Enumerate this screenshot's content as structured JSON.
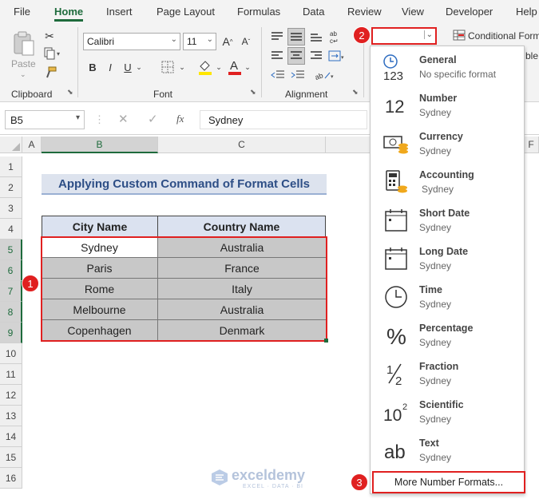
{
  "menu_tabs": [
    "File",
    "Home",
    "Insert",
    "Page Layout",
    "Formulas",
    "Data",
    "Review",
    "View",
    "Developer",
    "Help"
  ],
  "ribbon": {
    "clipboard": {
      "paste_label": "Paste",
      "group_label": "Clipboard"
    },
    "font": {
      "font_name": "Calibri",
      "font_size": "11",
      "group_label": "Font",
      "highlight_color": "#ffe600",
      "font_color": "#e02020"
    },
    "alignment": {
      "group_label": "Alignment"
    },
    "number": {
      "format_value": ""
    },
    "styles": {
      "conditional_label": "Conditional Form",
      "table_partial": "ble"
    }
  },
  "formula_bar": {
    "name_box": "B5",
    "fx": "fx",
    "content": "Sydney"
  },
  "grid": {
    "columns": [
      "A",
      "B",
      "C",
      "F"
    ],
    "rows": [
      "1",
      "2",
      "3",
      "4",
      "5",
      "6",
      "7",
      "8",
      "9",
      "10",
      "11",
      "12",
      "13",
      "14",
      "15",
      "16"
    ],
    "title": "Applying Custom Command of Format Cells",
    "headers": [
      "City Name",
      "Country Name"
    ],
    "data": [
      [
        "Sydney",
        "Australia"
      ],
      [
        "Paris",
        "France"
      ],
      [
        "Rome",
        "Italy"
      ],
      [
        "Melbourne",
        "Australia"
      ],
      [
        "Copenhagen",
        "Denmark"
      ]
    ]
  },
  "number_formats": [
    {
      "name": "General",
      "sub": "No specific format",
      "icon": "clock-123-icon"
    },
    {
      "name": "Number",
      "sub": "Sydney",
      "icon": "number-12-icon"
    },
    {
      "name": "Currency",
      "sub": "Sydney",
      "icon": "currency-icon"
    },
    {
      "name": "Accounting",
      "sub": "Sydney",
      "icon": "accounting-icon"
    },
    {
      "name": "Short Date",
      "sub": "Sydney",
      "icon": "calendar-icon"
    },
    {
      "name": "Long Date",
      "sub": "Sydney",
      "icon": "calendar-icon"
    },
    {
      "name": "Time",
      "sub": "Sydney",
      "icon": "clock-icon"
    },
    {
      "name": "Percentage",
      "sub": "Sydney",
      "icon": "percent-icon"
    },
    {
      "name": "Fraction",
      "sub": "Sydney",
      "icon": "fraction-icon"
    },
    {
      "name": "Scientific",
      "sub": "Sydney",
      "icon": "scientific-icon"
    },
    {
      "name": "Text",
      "sub": "Sydney",
      "icon": "text-ab-icon"
    }
  ],
  "more_formats_label": "More Number Formats...",
  "badges": [
    "1",
    "2",
    "3"
  ],
  "watermark": {
    "brand": "exceldemy",
    "tagline": "EXCEL · DATA · BI"
  },
  "colors": {
    "accent_green": "#1e6b3c",
    "highlight_red": "#e02020",
    "title_bg": "#dde3ee",
    "title_text": "#2d4e86",
    "header_bg": "#dbe2f0",
    "data_bg": "#c8c8c8"
  }
}
